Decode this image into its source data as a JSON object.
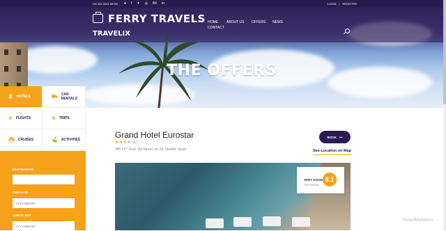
{
  "topbar": {
    "phone": "+45 345 3324 56789",
    "socials": [
      "google-plus-icon",
      "facebook-icon",
      "twitter-icon",
      "instagram-icon",
      "behance-icon",
      "linkedin-icon"
    ],
    "social_glyphs": [
      "●",
      "f",
      "✦",
      "◎",
      "Bē",
      "in"
    ],
    "login": "LOGIN",
    "separator": "|",
    "register": "REGISTER"
  },
  "header": {
    "brand": "FERRY TRAVELS",
    "sub": "TRAVELIX",
    "nav": {
      "home": "HOME",
      "about": "ABOUT US",
      "offers": "OFFERS",
      "news": "NEWS",
      "contact": "CONTACT"
    }
  },
  "hero": {
    "title": "THE OFFERS"
  },
  "sidebar": {
    "categories": [
      {
        "label": "HOTELS",
        "icon": "hotel-icon",
        "active": true
      },
      {
        "label": "CAR RENTALS",
        "icon": "car-icon",
        "active": false
      },
      {
        "label": "FLIGHTS",
        "icon": "plane-icon",
        "active": false
      },
      {
        "label": "TRIPS",
        "icon": "trip-icon",
        "active": false
      },
      {
        "label": "CRUISES",
        "icon": "cruise-icon",
        "active": false
      },
      {
        "label": "ACTIVITIES",
        "icon": "activity-icon",
        "active": false
      }
    ],
    "form": {
      "destination_label": "DESTINATION",
      "destination_value": "",
      "checkin_label": "CHECK IN",
      "checkin_placeholder": "YYYY-MM-DD",
      "checkout_label": "CHECK OUT",
      "checkout_placeholder": "YYYY-MM-DD"
    }
  },
  "hotel": {
    "name": "Grand Hotel Eurostar",
    "stars": 4,
    "stars_text": "★★★★",
    "review_count": "(5)",
    "address": "345 677 Gran Via Street, no 34, Madrid, Spain",
    "book_label": "BOOK",
    "book_arrow": "•••",
    "location_link": "See Location on Map",
    "rating_label": "VERY GOOD",
    "rating_reviews": "705 reviews",
    "rating_score": "8.1"
  },
  "watermark": "ScanMalware",
  "colors": {
    "accent": "#f7a21b",
    "primary": "#2b1a4f"
  }
}
